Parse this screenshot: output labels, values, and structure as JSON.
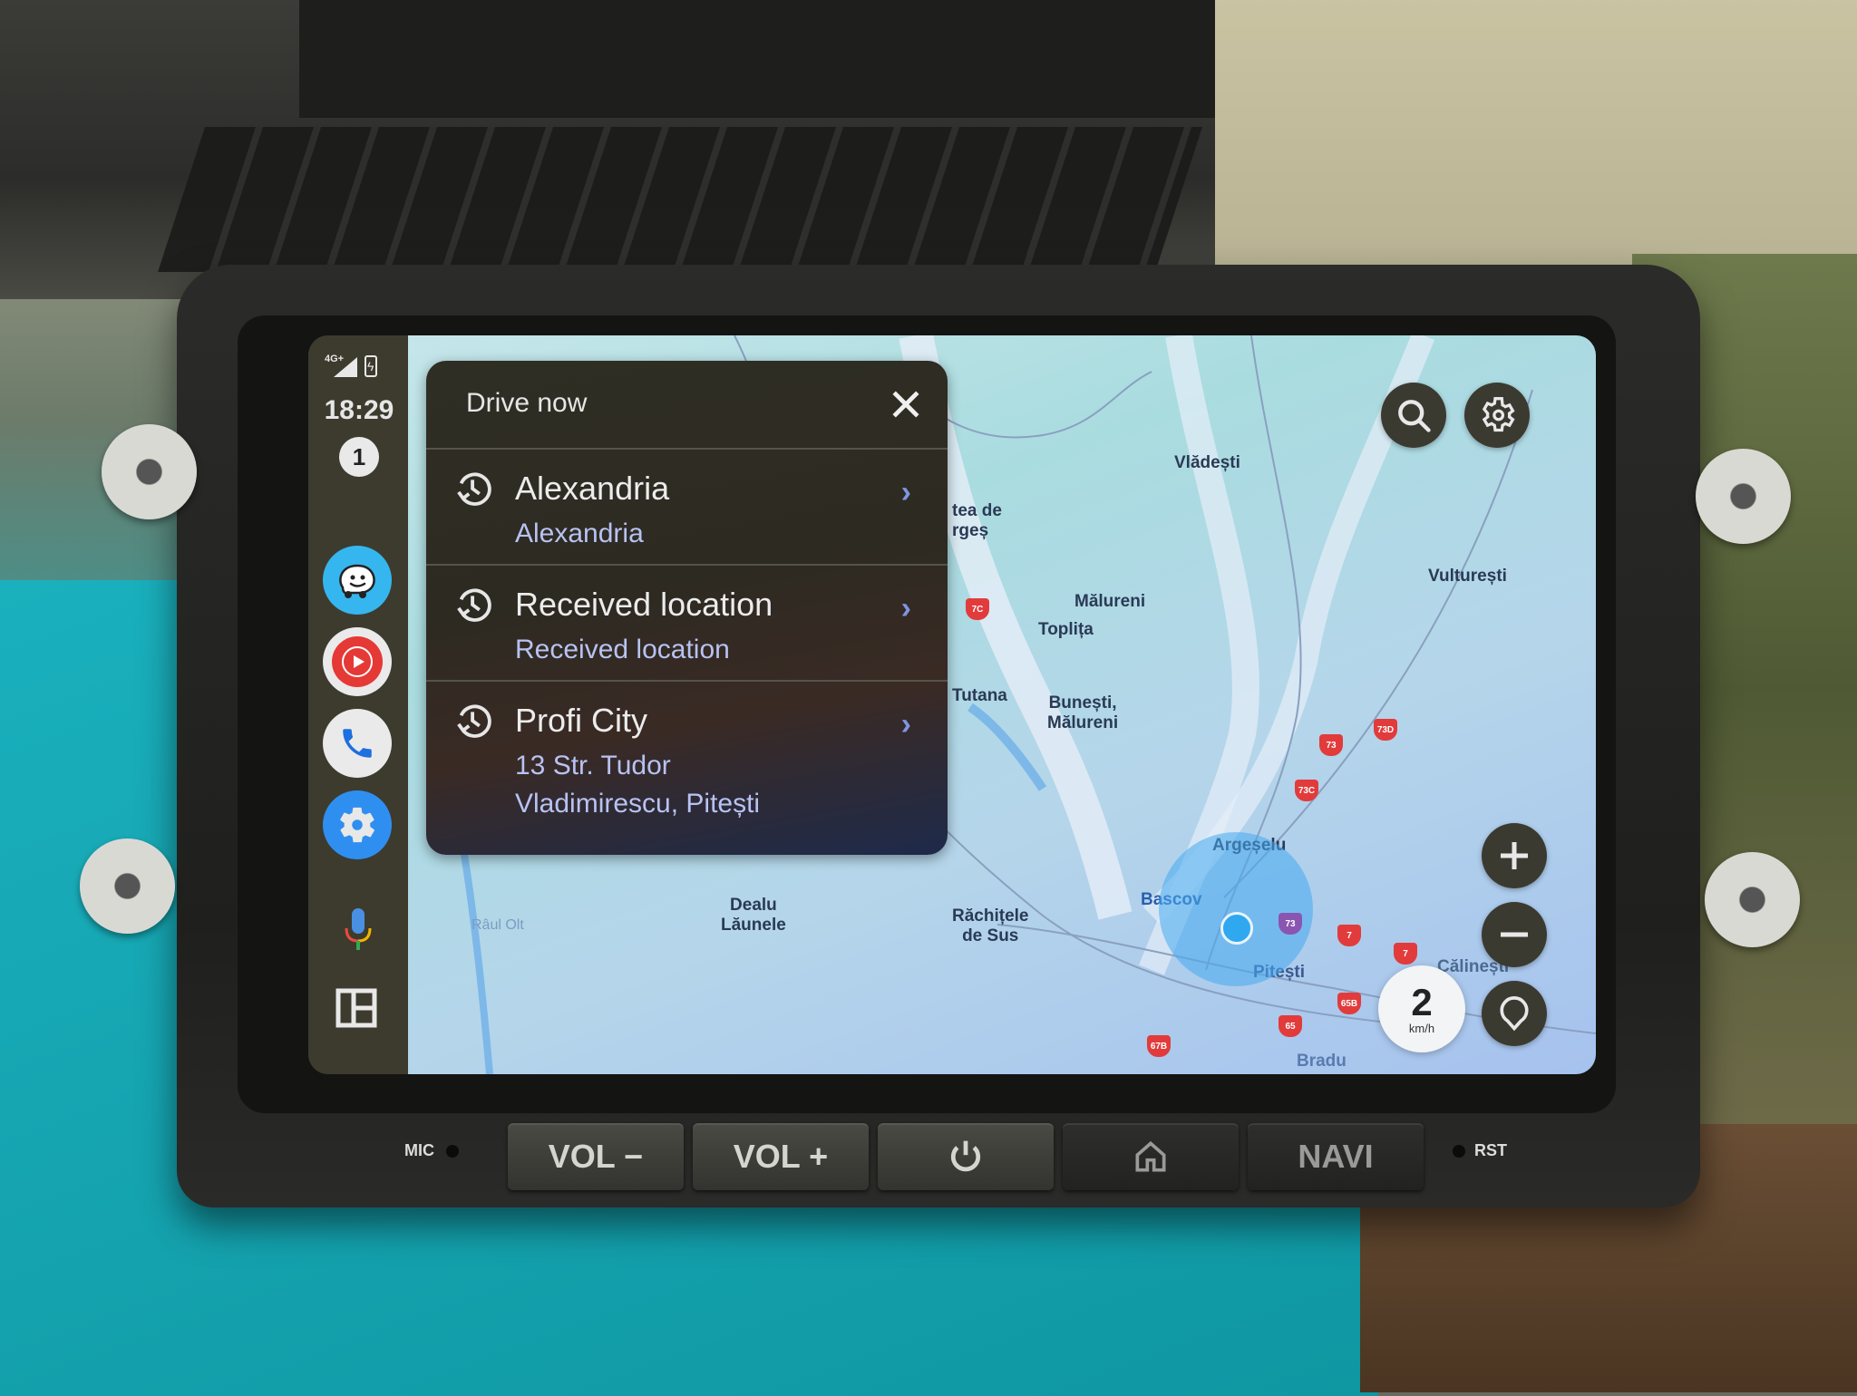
{
  "status_bar": {
    "network": "4G+",
    "time": "18:29",
    "notification_count": "1"
  },
  "rail": {
    "apps": [
      {
        "name": "Waze",
        "icon": "waze-icon",
        "color": "#35b6ee"
      },
      {
        "name": "YouTube Music",
        "icon": "youtube-music-icon",
        "color": "#e53935"
      },
      {
        "name": "Phone",
        "icon": "phone-icon",
        "color": "#1e6fe0"
      },
      {
        "name": "Settings",
        "icon": "settings-gear-icon",
        "color": "#2f8ff0"
      }
    ],
    "assistant_icon": "microphone-icon",
    "layout_icon": "layout-grid-icon"
  },
  "drive_now": {
    "title": "Drive now",
    "close_icon": "close-icon",
    "items": [
      {
        "title": "Alexandria",
        "subtitle": "Alexandria",
        "icon": "history-icon"
      },
      {
        "title": "Received location",
        "subtitle": "Received location",
        "icon": "history-icon"
      },
      {
        "title": "Profi City",
        "subtitle": "13 Str. Tudor\nVladimirescu, Pitești",
        "icon": "history-icon"
      }
    ]
  },
  "map": {
    "places": [
      {
        "name": "Vlădești"
      },
      {
        "name": "tea de\nrgeș"
      },
      {
        "name": "Vulturești"
      },
      {
        "name": "Mălureni"
      },
      {
        "name": "Toplița"
      },
      {
        "name": "Tutana"
      },
      {
        "name": "Bunești,\nMălureni"
      },
      {
        "name": "Argeșelu"
      },
      {
        "name": "Dealu\nLăunele"
      },
      {
        "name": "Răchițele\nde Sus"
      },
      {
        "name": "Bascov"
      },
      {
        "name": "Pitești"
      },
      {
        "name": "Călinești"
      },
      {
        "name": "Bradu"
      },
      {
        "name": "Râul Olt"
      }
    ],
    "road_shields": [
      "7C",
      "73",
      "73D",
      "73C",
      "73",
      "7",
      "7",
      "65B",
      "65",
      "67B"
    ],
    "speed": {
      "value": "2",
      "unit": "km/h"
    },
    "controls": {
      "search_icon": "search-icon",
      "settings_icon": "gear-icon",
      "zoom_in_icon": "plus-icon",
      "zoom_out_icon": "minus-icon",
      "recenter_icon": "location-pin-icon"
    }
  },
  "hardware": {
    "mic_label": "MIC",
    "buttons": [
      "VOL −",
      "VOL +",
      "power",
      "home",
      "NAVI"
    ],
    "rst_label": "RST"
  }
}
